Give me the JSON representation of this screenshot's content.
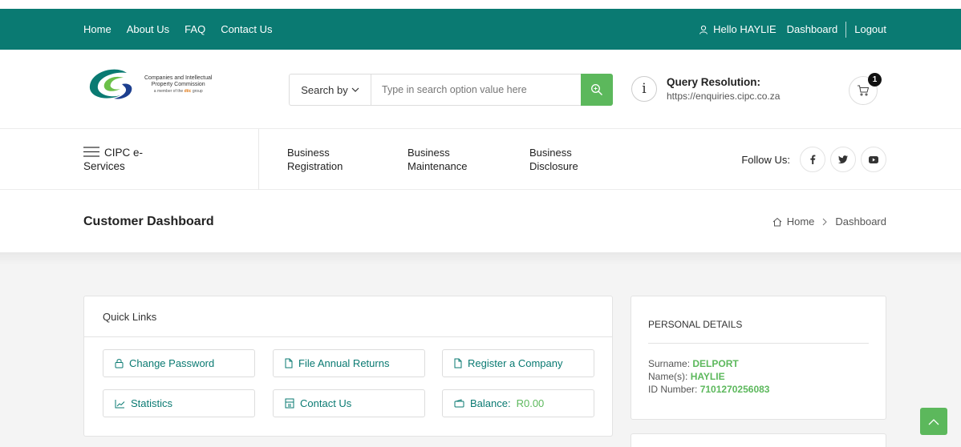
{
  "topbar": {
    "nav": [
      "Home",
      "About Us",
      "FAQ",
      "Contact Us"
    ],
    "greeting": "Hello HAYLIE",
    "dashboard": "Dashboard",
    "logout": "Logout"
  },
  "logo": {
    "line1": "Companies and Intellectual",
    "line2": "Property Commission",
    "member_prefix": "a member of the",
    "member_brand": "dtic",
    "member_suffix": "group"
  },
  "search": {
    "by_label": "Search by",
    "placeholder": "Type in search option value here"
  },
  "query": {
    "title": "Query Resolution:",
    "url": "https://enquiries.cipc.co.za"
  },
  "cart": {
    "count": "1"
  },
  "menu": {
    "cipc_line1": "CIPC e-",
    "cipc_line2": "Services",
    "items": [
      {
        "line1": "Business",
        "line2": "Registration"
      },
      {
        "line1": "Business",
        "line2": "Maintenance"
      },
      {
        "line1": "Business",
        "line2": "Disclosure"
      }
    ],
    "follow": "Follow Us:"
  },
  "page": {
    "title": "Customer Dashboard",
    "crumb_home": "Home",
    "crumb_current": "Dashboard"
  },
  "quick_links": {
    "title": "Quick Links",
    "change_password": "Change Password",
    "file_returns": "File Annual Returns",
    "register_company": "Register a Company",
    "statistics": "Statistics",
    "contact_us": "Contact Us",
    "balance_label": "Balance:",
    "balance_value": "R0.00"
  },
  "personal": {
    "title": "PERSONAL DETAILS",
    "surname_label": "Surname:",
    "surname": "DELPORT",
    "names_label": "Name(s):",
    "names": "HAYLIE",
    "id_label": "ID Number:",
    "id": "7101270256083"
  },
  "colors": {
    "teal": "#0a7a72",
    "green": "#5cb85c"
  }
}
